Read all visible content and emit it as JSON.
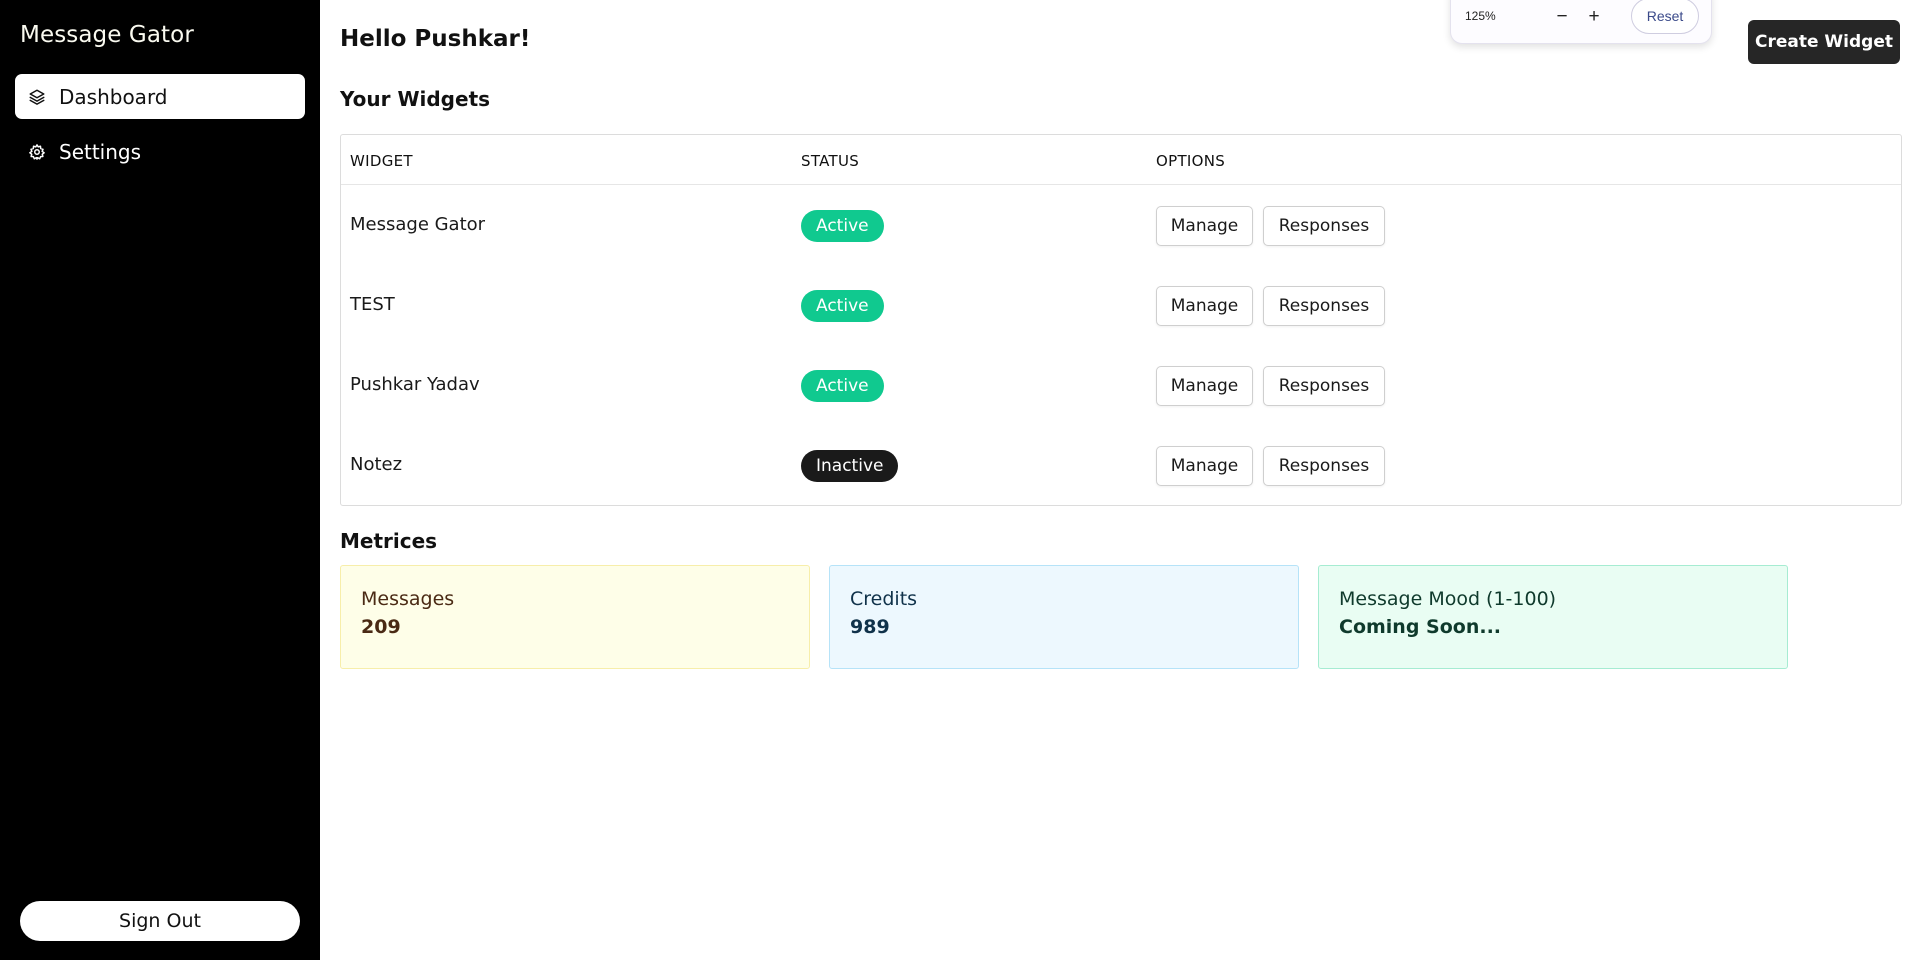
{
  "app": {
    "brand": "Message Gator"
  },
  "sidebar": {
    "items": [
      {
        "label": "Dashboard",
        "icon": "layers-icon",
        "active": true
      },
      {
        "label": "Settings",
        "icon": "gear-icon",
        "active": false
      }
    ],
    "sign_out_label": "Sign Out"
  },
  "header": {
    "greeting": "Hello Pushkar!",
    "create_label": "Create Widget"
  },
  "zoom": {
    "level": "125%",
    "decrease": "−",
    "increase": "+",
    "reset_label": "Reset"
  },
  "widgets": {
    "title": "Your Widgets",
    "columns": [
      "WIDGET",
      "STATUS",
      "OPTIONS"
    ],
    "rows": [
      {
        "name": "Message Gator",
        "status": "Active",
        "manage": "Manage",
        "responses": "Responses"
      },
      {
        "name": "TEST",
        "status": "Active",
        "manage": "Manage",
        "responses": "Responses"
      },
      {
        "name": "Pushkar Yadav",
        "status": "Active",
        "manage": "Manage",
        "responses": "Responses"
      },
      {
        "name": "Notez",
        "status": "Inactive",
        "manage": "Manage",
        "responses": "Responses"
      }
    ]
  },
  "metrics": {
    "title": "Metrices",
    "cards": [
      {
        "label": "Messages",
        "value": "209"
      },
      {
        "label": "Credits",
        "value": "989"
      },
      {
        "label": "Message Mood (1-100)",
        "value": "Coming Soon..."
      }
    ]
  },
  "colors": {
    "sidebar_bg": "#000000",
    "active_badge": "#10c98f",
    "inactive_badge": "#1a1a1a",
    "messages_card_bg": "#fefee8",
    "messages_card_border": "#f7eeaa",
    "messages_card_text": "#4a2a14",
    "credits_card_bg": "#edf8fe",
    "credits_card_border": "#b6e3f8",
    "credits_card_text": "#10324a",
    "mood_card_bg": "#e9fdf3",
    "mood_card_border": "#a6ecd2",
    "mood_card_text": "#0f3a2c"
  }
}
